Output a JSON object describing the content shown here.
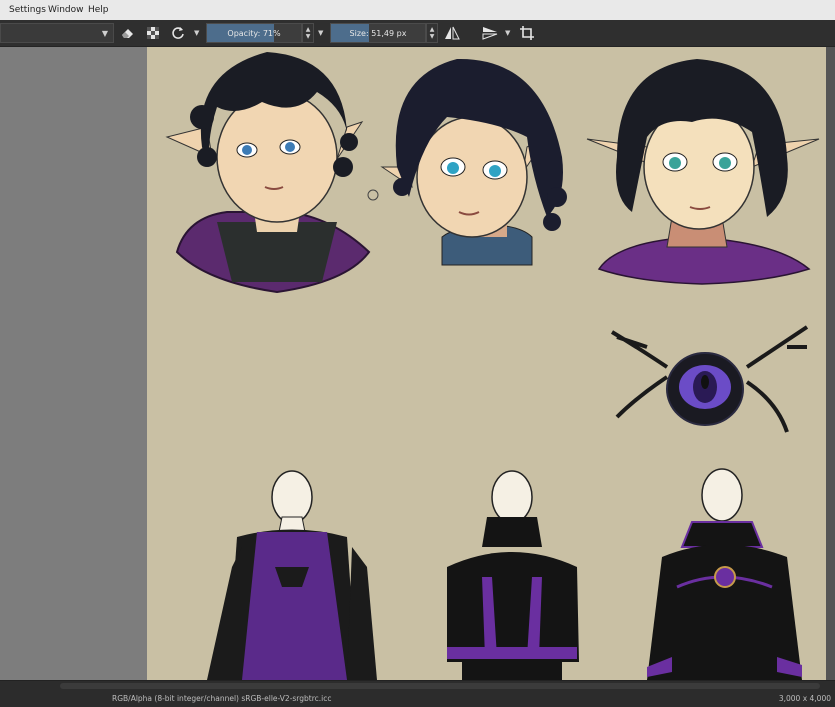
{
  "menubar": {
    "items": [
      {
        "label": "Settings",
        "name": "menu-settings"
      },
      {
        "label": "Window",
        "name": "menu-window"
      },
      {
        "label": "Help",
        "name": "menu-help"
      }
    ]
  },
  "toolbar": {
    "icons": [
      "eraser-icon",
      "alpha-lock-icon",
      "reload-preset-icon",
      "mirror-horizontal-icon",
      "mirror-vertical-icon",
      "crop-icon"
    ],
    "opacity_label": "Opacity: 71%",
    "opacity_value": 0.71,
    "size_label": "Size: 51,49 px"
  },
  "statusbar": {
    "color_info": "RGB/Alpha (8-bit integer/channel)  sRGB-elle-V2-srgbtrc.icc",
    "dimensions": "3,000 x 4,000"
  },
  "colors": {
    "canvas_bg": "#c9c0a4",
    "accent": "#4d6d8c",
    "purple": "#6a2f86",
    "hair": "#1a1c24",
    "skin": "#f1d6b2"
  }
}
